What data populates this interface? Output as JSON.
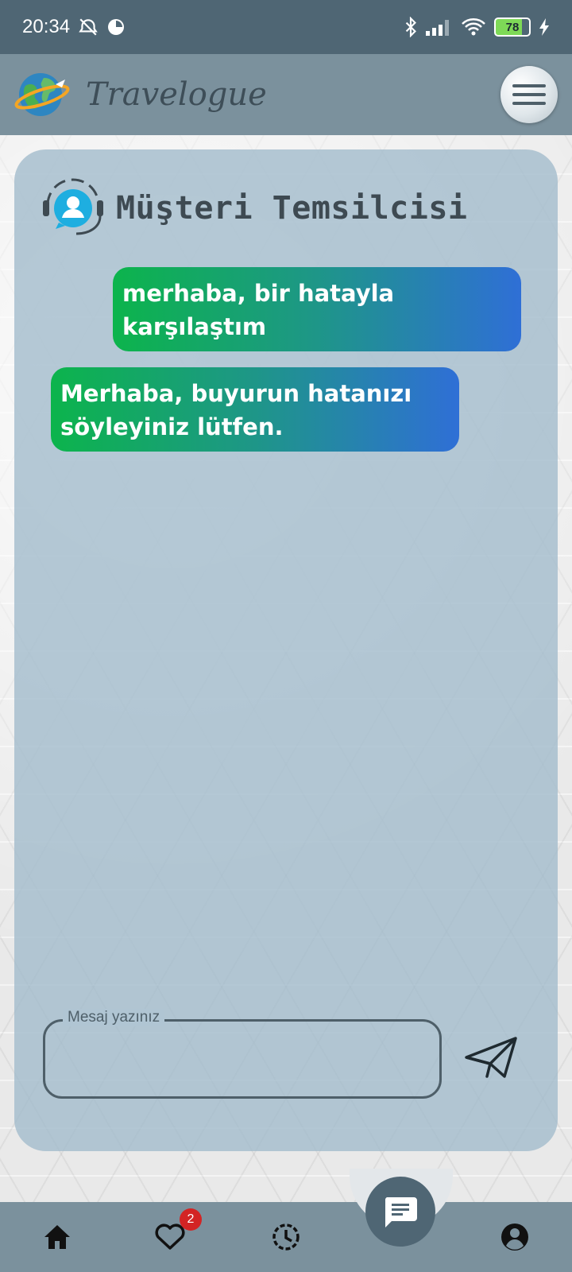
{
  "status_bar": {
    "time": "20:34",
    "battery": "78"
  },
  "app_bar": {
    "title": "Travelogue"
  },
  "chat": {
    "title": "Müşteri Temsilcisi",
    "messages": [
      {
        "from": "user",
        "text": "merhaba, bir hatayla karşılaştım"
      },
      {
        "from": "agent",
        "text": "Merhaba, buyurun hatanızı söyleyiniz lütfen."
      }
    ],
    "input": {
      "label": "Mesaj yazınız",
      "value": ""
    }
  },
  "bottom_nav": {
    "favorites_badge": "2"
  },
  "colors": {
    "bar": "#7b919d",
    "status_bar": "#4f6674",
    "bubble_start": "#0cb44c",
    "bubble_end": "#2f6fd6"
  }
}
